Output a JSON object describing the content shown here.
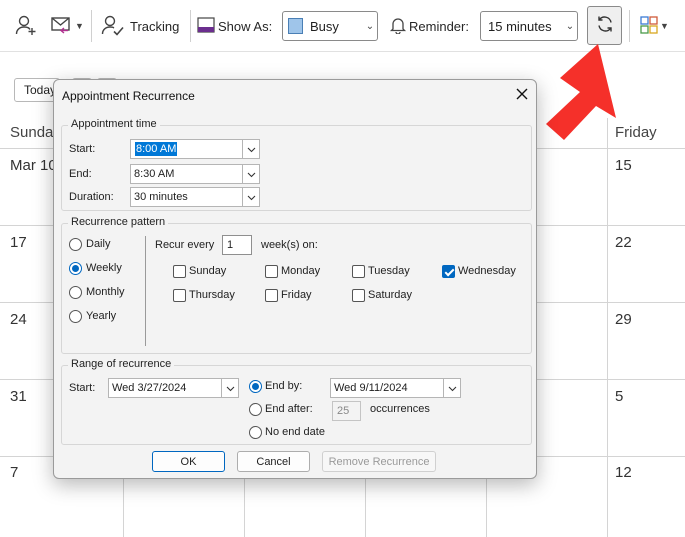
{
  "ribbon": {
    "tracking_label": "Tracking",
    "show_as_label": "Show As:",
    "show_as_value": "Busy",
    "reminder_label": "Reminder:",
    "reminder_value": "15 minutes"
  },
  "calendar": {
    "today_label": "Today",
    "day_headers": [
      "Sunday",
      "Friday"
    ],
    "dates": {
      "week1": [
        "Mar 10",
        "15"
      ],
      "week2": [
        "17",
        "22"
      ],
      "week3": [
        "24",
        "29"
      ],
      "week4": [
        "31",
        "5"
      ],
      "week5": [
        "7",
        "12"
      ]
    }
  },
  "dialog": {
    "title": "Appointment Recurrence",
    "appointment_time": {
      "title": "Appointment time",
      "start_label": "Start:",
      "start_value": "8:00 AM",
      "end_label": "End:",
      "end_value": "8:30 AM",
      "duration_label": "Duration:",
      "duration_value": "30 minutes"
    },
    "pattern": {
      "title": "Recurrence pattern",
      "options": [
        "Daily",
        "Weekly",
        "Monthly",
        "Yearly"
      ],
      "selected": "Weekly",
      "recur_every_label": "Recur every",
      "recur_every_value": "1",
      "weeks_on_label": "week(s) on:",
      "days": [
        {
          "label": "Sunday",
          "checked": false
        },
        {
          "label": "Monday",
          "checked": false
        },
        {
          "label": "Tuesday",
          "checked": false
        },
        {
          "label": "Wednesday",
          "checked": true
        },
        {
          "label": "Thursday",
          "checked": false
        },
        {
          "label": "Friday",
          "checked": false
        },
        {
          "label": "Saturday",
          "checked": false
        }
      ]
    },
    "range": {
      "title": "Range of recurrence",
      "start_label": "Start:",
      "start_value": "Wed 3/27/2024",
      "end_by_label": "End by:",
      "end_by_value": "Wed 9/11/2024",
      "end_after_label": "End after:",
      "end_after_value": "25",
      "occurrences_label": "occurrences",
      "no_end_label": "No end date",
      "selected": "End by:"
    },
    "buttons": {
      "ok": "OK",
      "cancel": "Cancel",
      "remove": "Remove Recurrence"
    }
  },
  "colors": {
    "accent": "#0067c0",
    "arrow": "#f5302a",
    "busy": "#9fc5ea"
  }
}
